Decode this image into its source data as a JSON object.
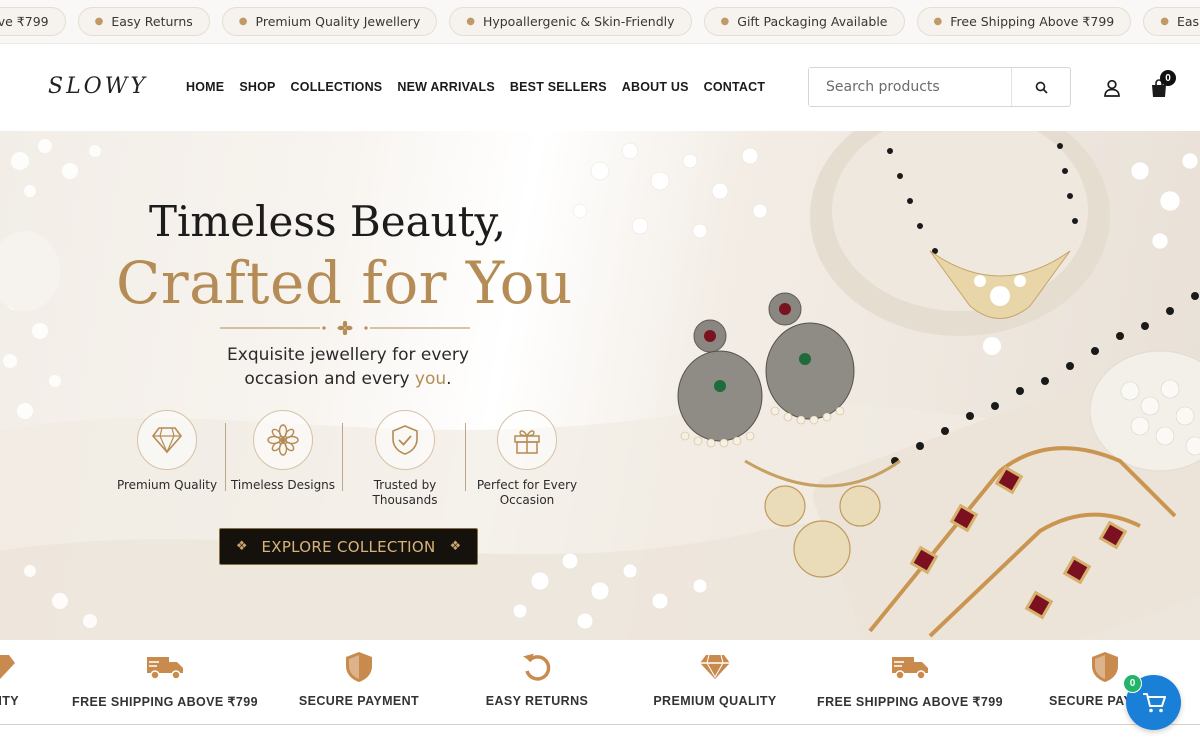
{
  "announcement": {
    "items": [
      "ve ₹799",
      "Easy Returns",
      "Premium Quality Jewellery",
      "Hypoallergenic & Skin-Friendly",
      "Gift Packaging Available",
      "Free Shipping Above ₹799",
      "Eas"
    ]
  },
  "header": {
    "logo": "SLOWY",
    "nav": [
      "HOME",
      "SHOP",
      "COLLECTIONS",
      "NEW ARRIVALS",
      "BEST SELLERS",
      "ABOUT US",
      "CONTACT"
    ],
    "search_placeholder": "Search products",
    "cart_count": "0"
  },
  "hero": {
    "title_line1": "Timeless Beauty,",
    "title_line2": "Crafted for You",
    "subtitle_part1": "Exquisite jewellery for every occasion and every ",
    "subtitle_highlight": "you",
    "subtitle_end": ".",
    "features": [
      {
        "label": "Premium Quality",
        "icon": "diamond-icon"
      },
      {
        "label": "Timeless Designs",
        "icon": "flower-icon"
      },
      {
        "label": "Trusted by Thousands",
        "icon": "shield-check-icon"
      },
      {
        "label": "Perfect for Every Occasion",
        "icon": "gift-icon"
      }
    ],
    "cta": "EXPLORE COLLECTION"
  },
  "strip": {
    "items": [
      {
        "label": "ALITY",
        "icon": "diamond-icon"
      },
      {
        "label": "FREE SHIPPING ABOVE ₹799",
        "icon": "truck-icon"
      },
      {
        "label": "SECURE PAYMENT",
        "icon": "shield-icon"
      },
      {
        "label": "EASY RETURNS",
        "icon": "return-icon"
      },
      {
        "label": "PREMIUM QUALITY",
        "icon": "diamond-icon"
      },
      {
        "label": "FREE SHIPPING ABOVE ₹799",
        "icon": "truck-icon"
      },
      {
        "label": "SECURE PAY",
        "icon": "shield-icon"
      }
    ]
  },
  "floating_cart": {
    "count": "0"
  },
  "colors": {
    "gold": "#b58c55",
    "dark": "#15120e",
    "strip_icon": "#c98a4d",
    "cart_blue": "#1a7fd6",
    "badge_green": "#23b46a"
  }
}
